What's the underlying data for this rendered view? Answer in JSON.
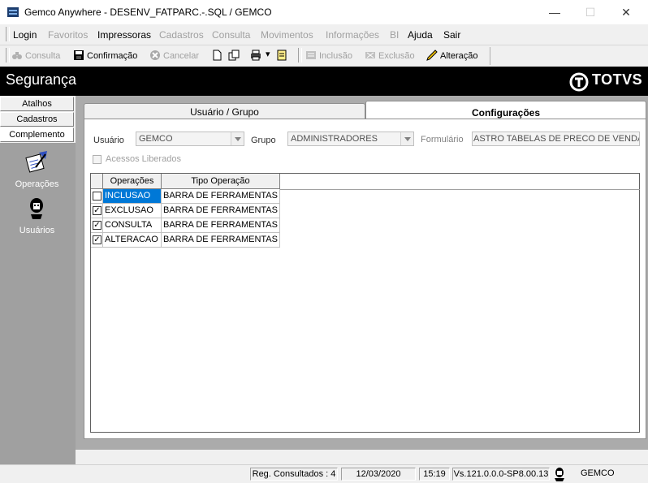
{
  "window": {
    "title": "Gemco Anywhere - DESENV_FATPARC.-.SQL / GEMCO"
  },
  "menu": [
    {
      "label": "Login",
      "enabled": true
    },
    {
      "label": "Favoritos",
      "enabled": false
    },
    {
      "label": "Impressoras",
      "enabled": true
    },
    {
      "label": "Cadastros",
      "enabled": false
    },
    {
      "label": "Consulta",
      "enabled": false
    },
    {
      "label": "Movimentos",
      "enabled": false
    },
    {
      "label": "Informações",
      "enabled": false
    },
    {
      "label": "BI",
      "enabled": false
    },
    {
      "label": "Ajuda",
      "enabled": true
    },
    {
      "label": "Sair",
      "enabled": true
    }
  ],
  "toolbar": {
    "consulta": "Consulta",
    "confirmacao": "Confirmação",
    "cancelar": "Cancelar",
    "inclusao": "Inclusão",
    "exclusao": "Exclusão",
    "alteracao": "Alteração"
  },
  "banner": {
    "title": "Segurança",
    "logo": "TOTVS"
  },
  "nav": {
    "tabs": [
      "Atalhos",
      "Cadastros",
      "Complemento"
    ],
    "items": [
      {
        "label": "Operações",
        "icon": "operations-icon"
      },
      {
        "label": "Usuários",
        "icon": "user-icon"
      }
    ]
  },
  "tabs": {
    "usuario_grupo": "Usuário  / Grupo",
    "configuracoes": "Configurações"
  },
  "filters": {
    "usuario_label": "Usuário",
    "usuario_value": "GEMCO",
    "grupo_label": "Grupo",
    "grupo_value": "ADMINISTRADORES",
    "formulario_label": "Formulário",
    "formulario_value": "ASTRO TABELAS DE PRECO DE VENDA",
    "acessos_label": "Acessos Liberados"
  },
  "grid": {
    "headers": [
      "Operações",
      "Tipo Operação"
    ],
    "rows": [
      {
        "checked": false,
        "op": "INCLUSAO",
        "tipo": "BARRA DE FERRAMENTAS",
        "selected": true
      },
      {
        "checked": true,
        "op": "EXCLUSAO",
        "tipo": "BARRA DE FERRAMENTAS",
        "selected": false
      },
      {
        "checked": true,
        "op": "CONSULTA",
        "tipo": "BARRA DE FERRAMENTAS",
        "selected": false
      },
      {
        "checked": true,
        "op": "ALTERACAO",
        "tipo": "BARRA DE FERRAMENTAS",
        "selected": false
      }
    ]
  },
  "status": {
    "reg": "Reg. Consultados : 4",
    "date": "12/03/2020",
    "time": "15:19",
    "version": "Vs.121.0.0.0-SP8.00.13",
    "user": "GEMCO"
  },
  "colors": {
    "selection": "#0078d7",
    "banner": "#000000",
    "panel": "#ababab"
  }
}
